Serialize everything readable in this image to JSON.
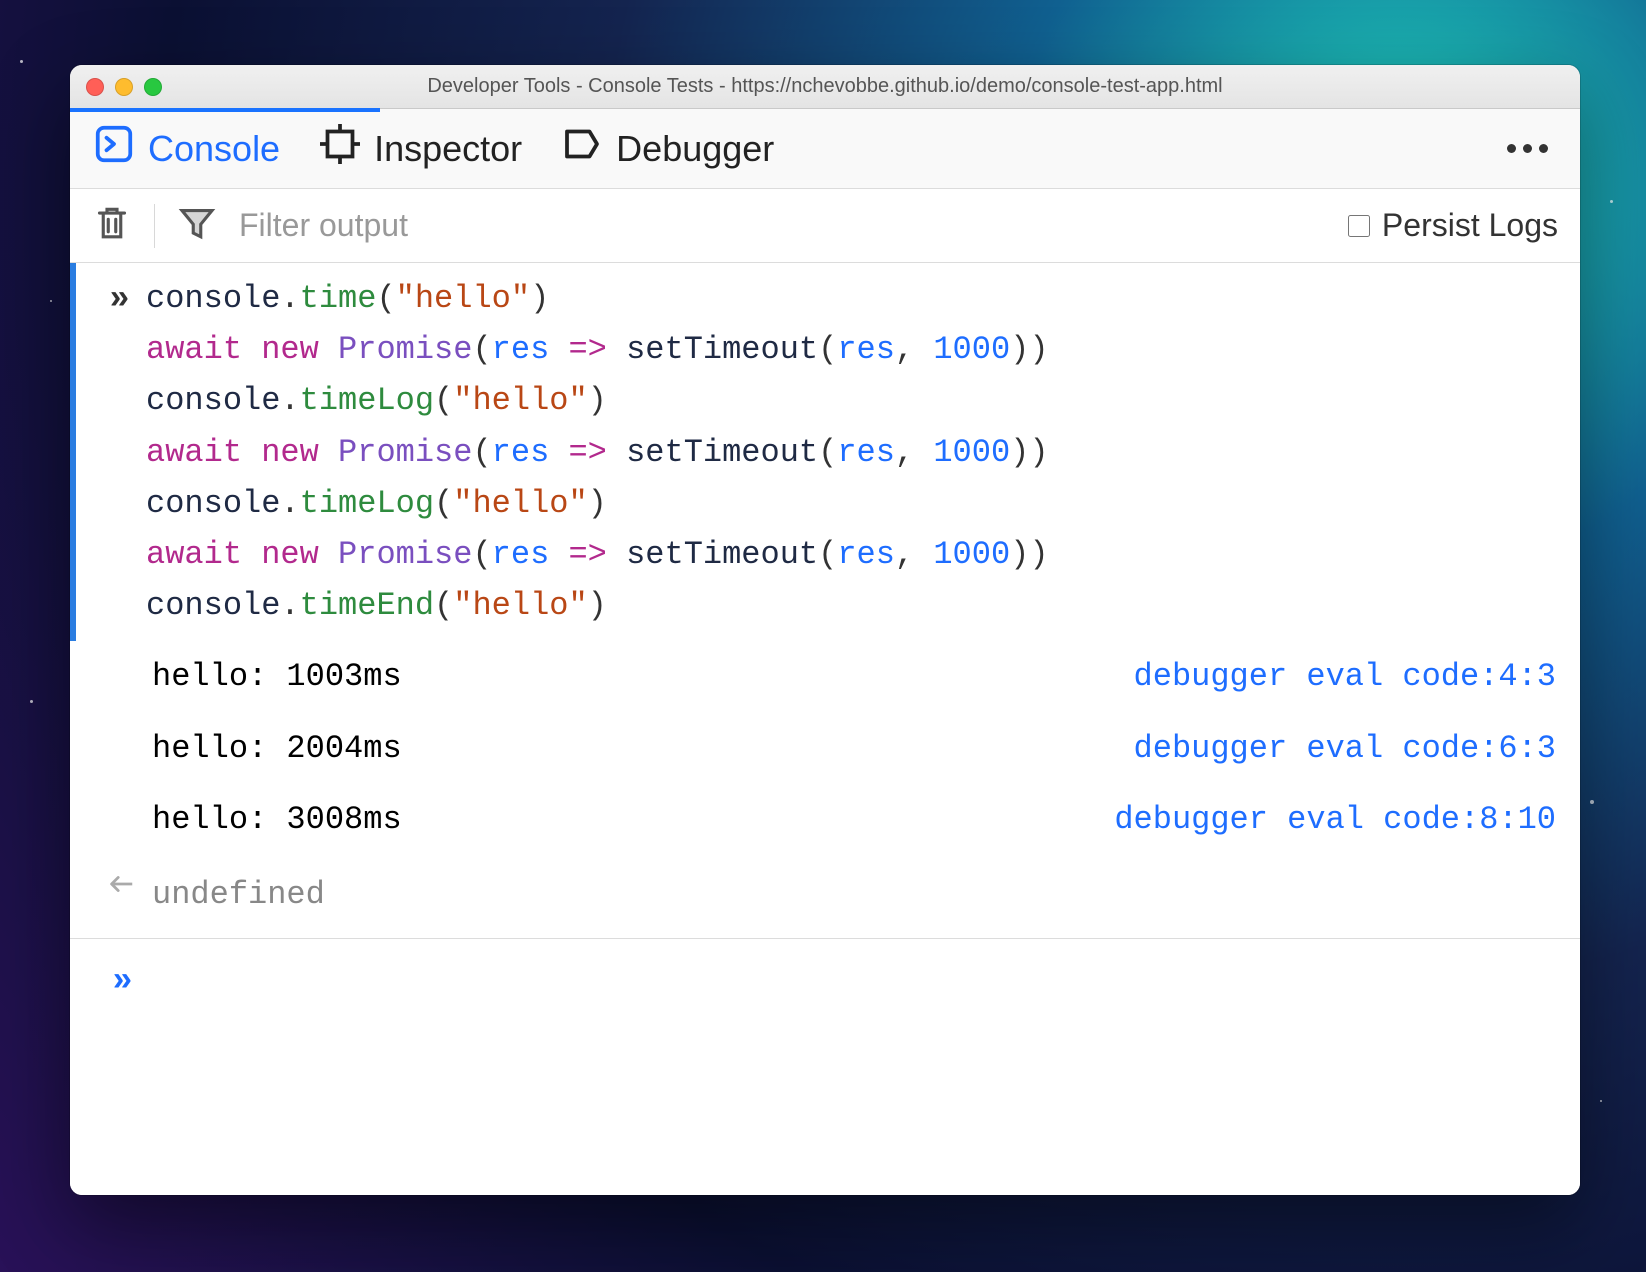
{
  "window": {
    "title": "Developer Tools - Console Tests - https://nchevobbe.github.io/demo/console-test-app.html"
  },
  "tabs": {
    "console": "Console",
    "inspector": "Inspector",
    "debugger": "Debugger"
  },
  "toolbar": {
    "filter_placeholder": "Filter output",
    "persist_label": "Persist Logs"
  },
  "input": {
    "lines": [
      [
        {
          "t": "obj",
          "v": "console"
        },
        {
          "t": "op",
          "v": "."
        },
        {
          "t": "prop",
          "v": "time"
        },
        {
          "t": "op",
          "v": "("
        },
        {
          "t": "str",
          "v": "\"hello\""
        },
        {
          "t": "op",
          "v": ")"
        }
      ],
      [
        {
          "t": "kw",
          "v": "await"
        },
        {
          "t": "op",
          "v": " "
        },
        {
          "t": "kw",
          "v": "new"
        },
        {
          "t": "op",
          "v": " "
        },
        {
          "t": "fn",
          "v": "Promise"
        },
        {
          "t": "op",
          "v": "("
        },
        {
          "t": "var",
          "v": "res"
        },
        {
          "t": "op",
          "v": " "
        },
        {
          "t": "kw",
          "v": "=>"
        },
        {
          "t": "op",
          "v": " "
        },
        {
          "t": "obj",
          "v": "setTimeout"
        },
        {
          "t": "op",
          "v": "("
        },
        {
          "t": "var",
          "v": "res"
        },
        {
          "t": "op",
          "v": ", "
        },
        {
          "t": "num",
          "v": "1000"
        },
        {
          "t": "op",
          "v": "))"
        }
      ],
      [
        {
          "t": "obj",
          "v": "console"
        },
        {
          "t": "op",
          "v": "."
        },
        {
          "t": "prop",
          "v": "timeLog"
        },
        {
          "t": "op",
          "v": "("
        },
        {
          "t": "str",
          "v": "\"hello\""
        },
        {
          "t": "op",
          "v": ")"
        }
      ],
      [
        {
          "t": "kw",
          "v": "await"
        },
        {
          "t": "op",
          "v": " "
        },
        {
          "t": "kw",
          "v": "new"
        },
        {
          "t": "op",
          "v": " "
        },
        {
          "t": "fn",
          "v": "Promise"
        },
        {
          "t": "op",
          "v": "("
        },
        {
          "t": "var",
          "v": "res"
        },
        {
          "t": "op",
          "v": " "
        },
        {
          "t": "kw",
          "v": "=>"
        },
        {
          "t": "op",
          "v": " "
        },
        {
          "t": "obj",
          "v": "setTimeout"
        },
        {
          "t": "op",
          "v": "("
        },
        {
          "t": "var",
          "v": "res"
        },
        {
          "t": "op",
          "v": ", "
        },
        {
          "t": "num",
          "v": "1000"
        },
        {
          "t": "op",
          "v": "))"
        }
      ],
      [
        {
          "t": "obj",
          "v": "console"
        },
        {
          "t": "op",
          "v": "."
        },
        {
          "t": "prop",
          "v": "timeLog"
        },
        {
          "t": "op",
          "v": "("
        },
        {
          "t": "str",
          "v": "\"hello\""
        },
        {
          "t": "op",
          "v": ")"
        }
      ],
      [
        {
          "t": "kw",
          "v": "await"
        },
        {
          "t": "op",
          "v": " "
        },
        {
          "t": "kw",
          "v": "new"
        },
        {
          "t": "op",
          "v": " "
        },
        {
          "t": "fn",
          "v": "Promise"
        },
        {
          "t": "op",
          "v": "("
        },
        {
          "t": "var",
          "v": "res"
        },
        {
          "t": "op",
          "v": " "
        },
        {
          "t": "kw",
          "v": "=>"
        },
        {
          "t": "op",
          "v": " "
        },
        {
          "t": "obj",
          "v": "setTimeout"
        },
        {
          "t": "op",
          "v": "("
        },
        {
          "t": "var",
          "v": "res"
        },
        {
          "t": "op",
          "v": ", "
        },
        {
          "t": "num",
          "v": "1000"
        },
        {
          "t": "op",
          "v": "))"
        }
      ],
      [
        {
          "t": "obj",
          "v": "console"
        },
        {
          "t": "op",
          "v": "."
        },
        {
          "t": "prop",
          "v": "timeEnd"
        },
        {
          "t": "op",
          "v": "("
        },
        {
          "t": "str",
          "v": "\"hello\""
        },
        {
          "t": "op",
          "v": ")"
        }
      ]
    ]
  },
  "logs": [
    {
      "msg": "hello: 1003ms",
      "src": "debugger eval code:4:3"
    },
    {
      "msg": "hello: 2004ms",
      "src": "debugger eval code:6:3"
    },
    {
      "msg": "hello: 3008ms",
      "src": "debugger eval code:8:10"
    }
  ],
  "return_value": "undefined"
}
